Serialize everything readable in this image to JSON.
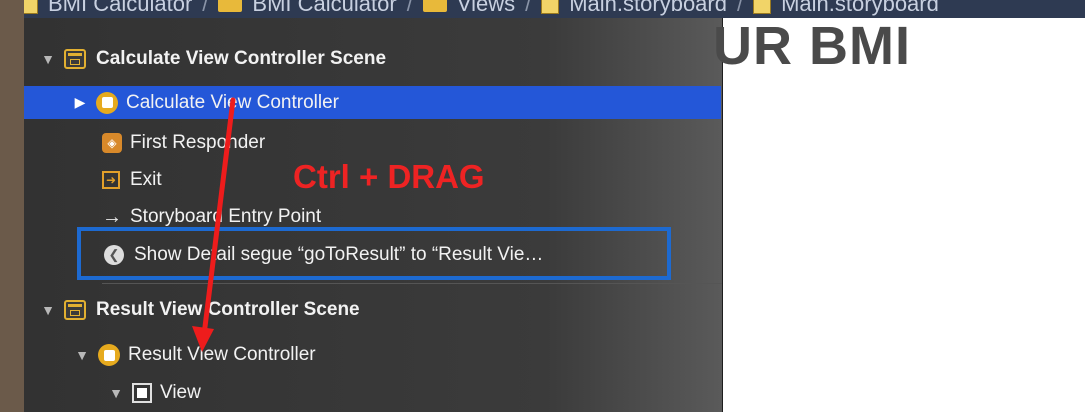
{
  "breadcrumb": {
    "items": [
      "BMI Calculator",
      "BMI Calculator",
      "Views",
      "Main.storyboard",
      "Main.storyboard"
    ],
    "separator": "/"
  },
  "canvas": {
    "title": "UR BMI"
  },
  "outline": {
    "calculate_scene": {
      "label": "Calculate View Controller Scene",
      "disclosure": "expanded"
    },
    "calculate_vc": {
      "label": "Calculate View Controller",
      "selected": true,
      "disclosure": "collapsed"
    },
    "first_responder": {
      "label": "First Responder"
    },
    "exit": {
      "label": "Exit"
    },
    "entry_point": {
      "label": "Storyboard Entry Point"
    },
    "segue": {
      "label": "Show Detail segue “goToResult” to “Result Vie…"
    },
    "result_scene": {
      "label": "Result View Controller Scene",
      "disclosure": "expanded"
    },
    "result_vc": {
      "label": "Result View Controller",
      "disclosure": "expanded"
    },
    "view": {
      "label": "View",
      "disclosure": "expanded"
    }
  },
  "annotation": {
    "text": "Ctrl + DRAG",
    "color": "#ee2323"
  },
  "colors": {
    "selection": "#2457d8",
    "highlight_box": "#1d6ad1",
    "scene_icon": "#e2b031",
    "vc_icon": "#e6aa1e"
  },
  "icons": [
    "scene-icon",
    "view-controller-icon",
    "first-responder-icon",
    "exit-icon",
    "entry-arrow-icon",
    "segue-icon",
    "view-icon",
    "disclosure-triangle-icon"
  ]
}
